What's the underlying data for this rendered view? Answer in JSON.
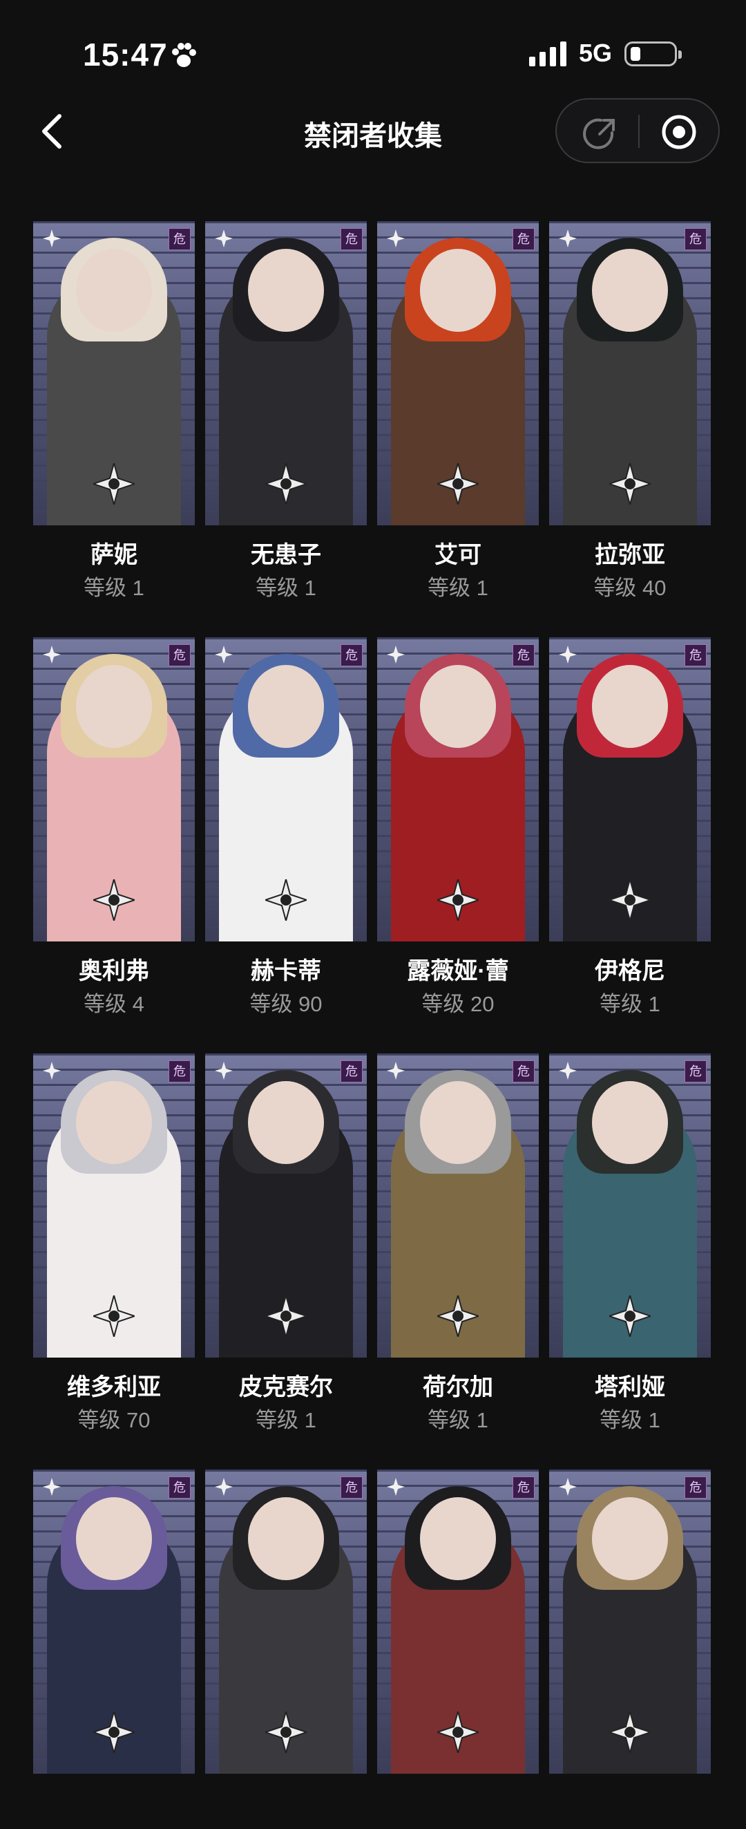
{
  "status_bar": {
    "time": "15:47",
    "network": "5G"
  },
  "header": {
    "title": "禁闭者收集"
  },
  "characters": [
    {
      "name": "萨妮",
      "level": "等级 1",
      "hair": "#e6dccf",
      "outfit": "#4a4a4a"
    },
    {
      "name": "无患子",
      "level": "等级 1",
      "hair": "#1e1e22",
      "outfit": "#2b2b2f"
    },
    {
      "name": "艾可",
      "level": "等级 1",
      "hair": "#c9431f",
      "outfit": "#5a3b2c"
    },
    {
      "name": "拉弥亚",
      "level": "等级 40",
      "hair": "#1c1f1f",
      "outfit": "#3a3a3a"
    },
    {
      "name": "奥利弗",
      "level": "等级 4",
      "hair": "#e3cda4",
      "outfit": "#e9b3b5"
    },
    {
      "name": "赫卡蒂",
      "level": "等级 90",
      "hair": "#4f6aa6",
      "outfit": "#f0f0f0"
    },
    {
      "name": "露薇娅·蕾",
      "level": "等级 20",
      "hair": "#b8455a",
      "outfit": "#9e1e22"
    },
    {
      "name": "伊格尼",
      "level": "等级 1",
      "hair": "#c0283a",
      "outfit": "#1f1f24"
    },
    {
      "name": "维多利亚",
      "level": "等级 70",
      "hair": "#c9c9cf",
      "outfit": "#f1ecec"
    },
    {
      "name": "皮克赛尔",
      "level": "等级 1",
      "hair": "#2c2c30",
      "outfit": "#1f1f24"
    },
    {
      "name": "荷尔加",
      "level": "等级 1",
      "hair": "#9a9a9a",
      "outfit": "#7e6b46"
    },
    {
      "name": "塔利娅",
      "level": "等级 1",
      "hair": "#2b2f2d",
      "outfit": "#3a6470"
    },
    {
      "name": "",
      "level": "",
      "hair": "#6a5b9a",
      "outfit": "#2a2f48"
    },
    {
      "name": "",
      "level": "",
      "hair": "#232325",
      "outfit": "#3a3a3e"
    },
    {
      "name": "",
      "level": "",
      "hair": "#1d1d20",
      "outfit": "#7a3030"
    },
    {
      "name": "",
      "level": "",
      "hair": "#9a8460",
      "outfit": "#2a2a2e"
    }
  ]
}
